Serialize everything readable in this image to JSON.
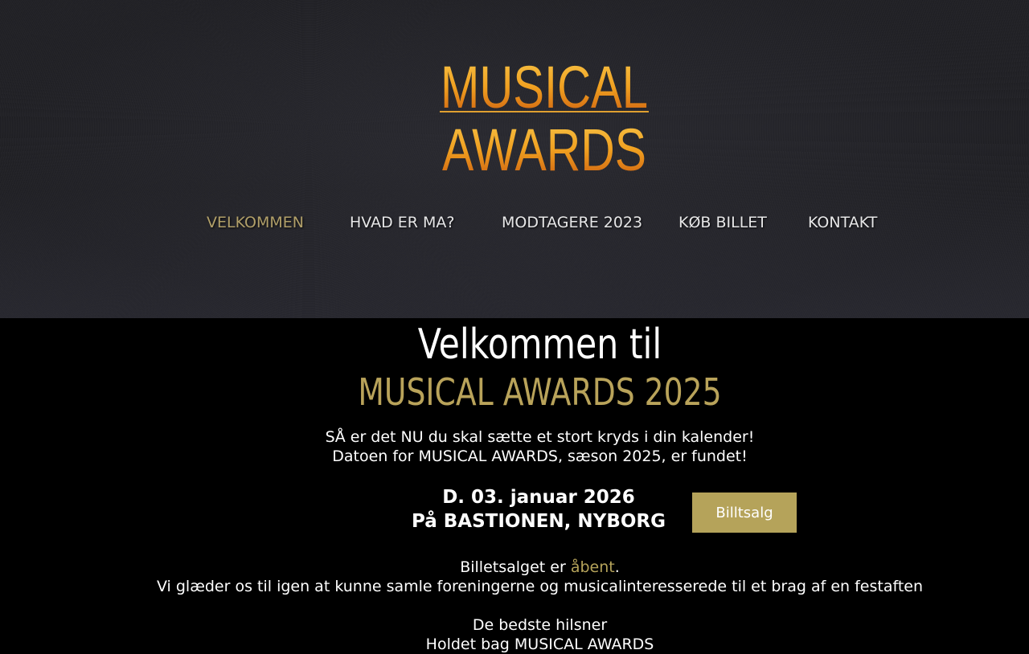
{
  "header": {
    "logo": {
      "line1": "MUSICAL",
      "line2": "AWARDS"
    },
    "nav": [
      {
        "label": "VELKOMMEN",
        "active": true
      },
      {
        "label": "HVAD ER MA?",
        "active": false
      },
      {
        "label": "MODTAGERE 2023",
        "active": false
      },
      {
        "label": "KØB BILLET",
        "active": false
      },
      {
        "label": "KONTAKT",
        "active": false
      }
    ]
  },
  "main": {
    "title": "Velkommen til",
    "subtitle": "MUSICAL AWARDS 2025",
    "intro_line1": "SÅ er det NU du skal sætte et stort kryds i din kalender!",
    "intro_line2": "Datoen for MUSICAL AWARDS, sæson 2025, er fundet!",
    "date_line": "D. 03. januar 2026",
    "venue_line": "På BASTIONEN, NYBORG",
    "ticket_button": "Billtsalg",
    "sales_prefix": "Billetsalget er ",
    "sales_status": "åbent",
    "sales_suffix": ".",
    "sales_line2": "Vi glæder os til igen at kunne samle foreningerne og musicalinteresserede til et brag af en festaften",
    "greeting": "De bedste hilsner",
    "signature": "Holdet bag MUSICAL AWARDS"
  },
  "colors": {
    "accent_gold": "#b5a35a",
    "nav_active": "#b9a66b",
    "background": "#000000"
  }
}
